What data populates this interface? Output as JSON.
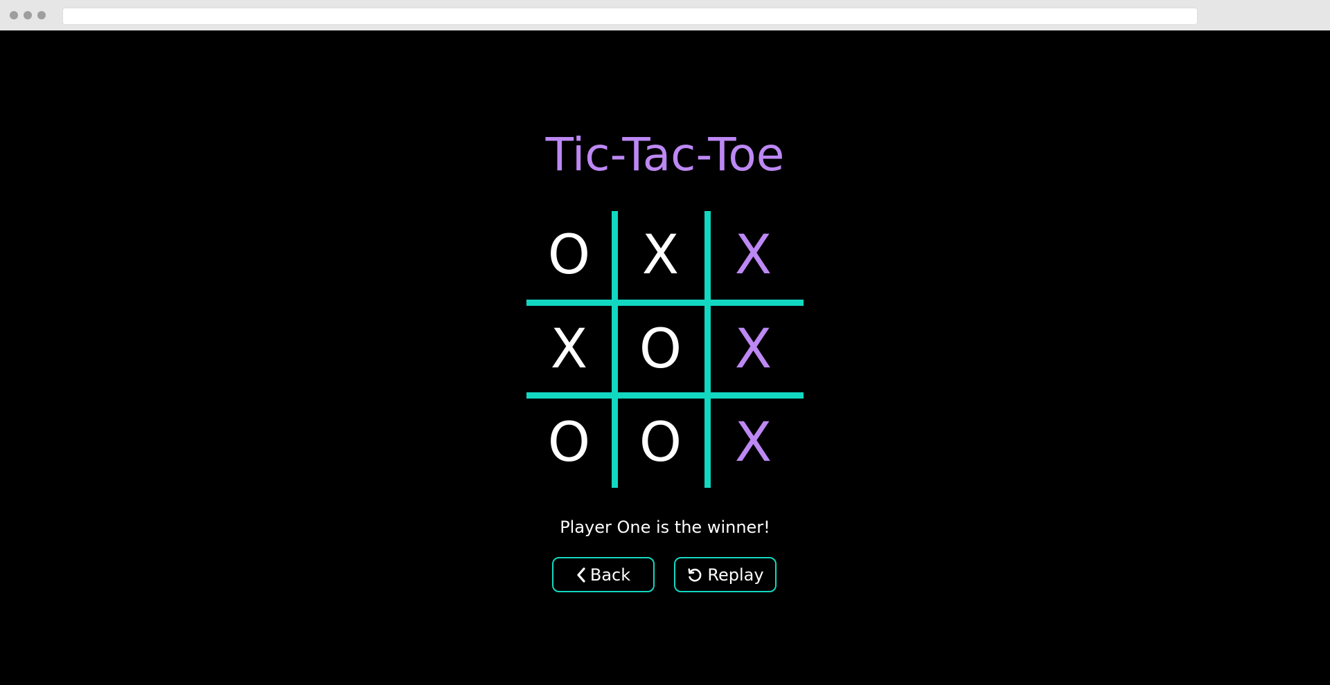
{
  "game": {
    "title": "Tic-Tac-Toe",
    "board": [
      [
        {
          "mark": "O",
          "winning": false
        },
        {
          "mark": "X",
          "winning": false
        },
        {
          "mark": "X",
          "winning": true
        }
      ],
      [
        {
          "mark": "X",
          "winning": false
        },
        {
          "mark": "O",
          "winning": false
        },
        {
          "mark": "X",
          "winning": true
        }
      ],
      [
        {
          "mark": "O",
          "winning": false
        },
        {
          "mark": "O",
          "winning": false
        },
        {
          "mark": "X",
          "winning": true
        }
      ]
    ],
    "status": "Player One is the winner!"
  },
  "buttons": {
    "back": {
      "label": "Back",
      "icon": "chevron-left-icon"
    },
    "replay": {
      "label": "Replay",
      "icon": "replay-icon"
    }
  },
  "colors": {
    "accent": "#bd88f4",
    "grid": "#12d8c1",
    "mark": "#ffffff",
    "background": "#000000"
  }
}
